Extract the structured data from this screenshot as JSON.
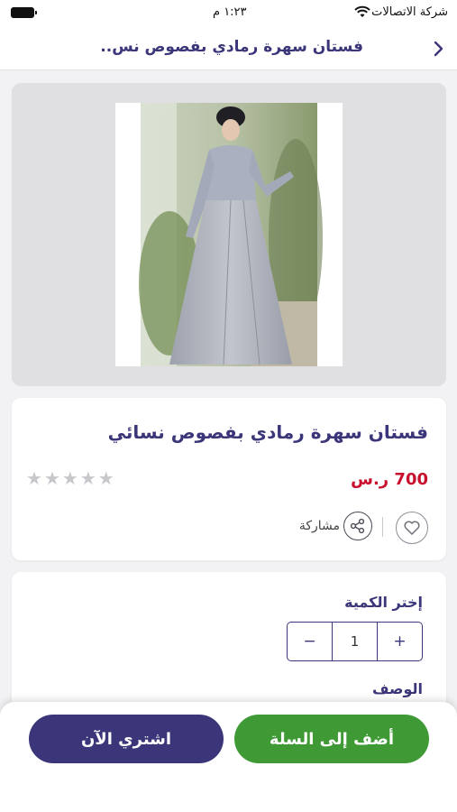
{
  "status_bar": {
    "carrier": "شركة الاتصالات",
    "time": "١:٢٣ م"
  },
  "nav": {
    "title": "فستان سهرة رمادي بفصوص نس..",
    "back_icon": "chevron-right-icon"
  },
  "product": {
    "name": "فستان سهرة رمادي بفصوص نسائي",
    "price": "700 ر.س",
    "rating": 0,
    "rating_max": 5,
    "share_label": "مشاركة",
    "colors": {
      "primary": "#3b3679",
      "price": "#c8102e",
      "cart": "#3f9a36"
    }
  },
  "quantity": {
    "label": "إختر الكمية",
    "value": "1",
    "minus": "−",
    "plus": "+"
  },
  "description": {
    "label": "الوصف"
  },
  "actions": {
    "add_to_cart": "أضف إلى السلة",
    "buy_now": "اشتري الآن"
  }
}
